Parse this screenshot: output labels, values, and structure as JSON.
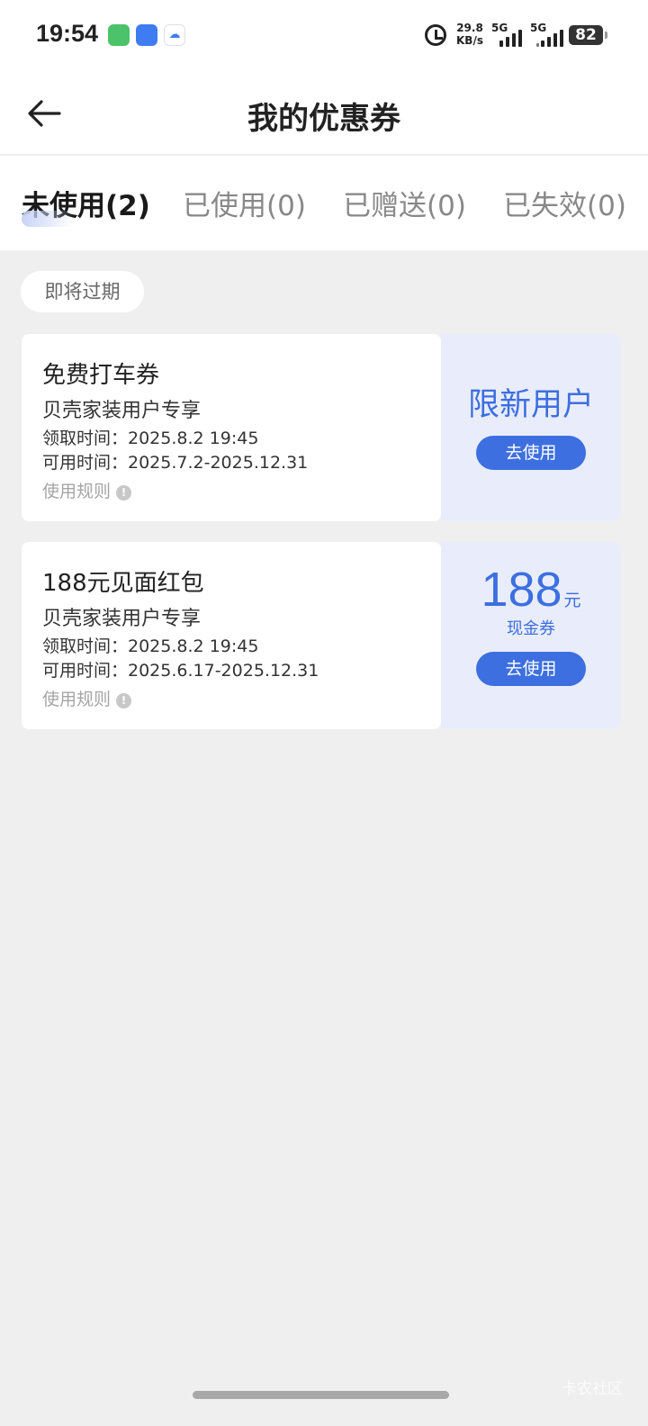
{
  "status_bar": {
    "time": "19:54",
    "net_speed_value": "29.8",
    "net_speed_unit": "KB/s",
    "sim1_label": "5G",
    "sim2_label": "5G",
    "battery": "82",
    "icons": [
      "phone-app-icon",
      "browser-app-icon",
      "cloud-app-icon",
      "alarm-icon",
      "signal-icon",
      "battery-icon"
    ]
  },
  "header": {
    "title": "我的优惠券",
    "back_icon": "back-arrow-icon"
  },
  "tabs": [
    {
      "label": "未使用(2)",
      "active": true
    },
    {
      "label": "已使用(0)",
      "active": false
    },
    {
      "label": "已赠送(0)",
      "active": false
    },
    {
      "label": "已失效(0)",
      "active": false
    }
  ],
  "section": {
    "chip_label": "即将过期"
  },
  "coupons": [
    {
      "name": "免费打车券",
      "subtitle": "贝壳家装用户专享",
      "received": "领取时间：2025.8.2 19:45",
      "valid": "可用时间：2025.7.2-2025.12.31",
      "rules": "使用规则",
      "badge": "限新用户",
      "button": "去使用"
    },
    {
      "name": "188元见面红包",
      "subtitle": "贝壳家装用户专享",
      "received": "领取时间：2025.8.2 19:45",
      "valid": "可用时间：2025.6.17-2025.12.31",
      "rules": "使用规则",
      "amount": "188",
      "amount_unit": "元",
      "amount_type": "现金券",
      "button": "去使用"
    }
  ],
  "watermark": "卡农社区",
  "colors": {
    "accent": "#3d6fe0",
    "coupon_right_bg": "#e9edfb",
    "page_bg": "#efefef"
  }
}
